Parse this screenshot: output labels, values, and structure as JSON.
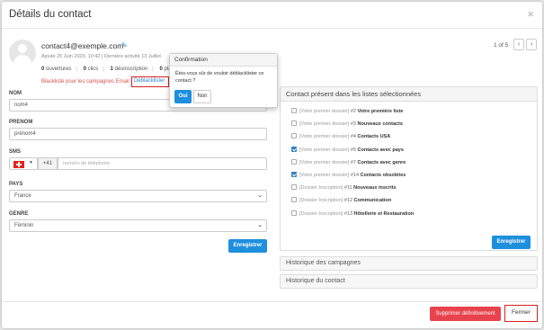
{
  "window": {
    "title": "Détails du contact",
    "close_icon": "×"
  },
  "contact": {
    "email": "contact4@exemple.com",
    "added": "Ajouté 25 Juin 2020, 10:42 | Dernière activité 13 Juillet",
    "stats": {
      "opens_value": "0",
      "opens_label": "ouvertures",
      "clicks_value": "0",
      "clicks_label": "clics",
      "unsub_value": "1",
      "unsub_label": "désinscription",
      "complaints_value": "0",
      "complaints_label": "plai"
    },
    "blacklist_text": "Blacklisté pour les campagnes Email &",
    "unblacklist_link": "Déblacklister"
  },
  "pager": {
    "text": "1 of 5",
    "prev": "‹",
    "next": "›"
  },
  "form": {
    "nom_label": "NOM",
    "nom_value": "nom4",
    "prenom_label": "PRENOM",
    "prenom_value": "prénom4",
    "sms_label": "SMS",
    "dial_code": "+41",
    "phone_placeholder": "numéro de téléphone",
    "pays_label": "PAYS",
    "pays_value": "France",
    "genre_label": "GENRE",
    "genre_value": "Féminin",
    "save_label": "Enregistrer"
  },
  "lists_panel": {
    "title": "Contact présent dans les listes sélectionnées",
    "items": [
      {
        "folder": "[Votre premier dossier]",
        "num": "#2",
        "name": "Votre première liste",
        "checked": false
      },
      {
        "folder": "[Votre premier dossier]",
        "num": "#3",
        "name": "Nouveaux contacts",
        "checked": false
      },
      {
        "folder": "[Votre premier dossier]",
        "num": "#4",
        "name": "Contacts USA",
        "checked": false
      },
      {
        "folder": "[Votre premier dossier]",
        "num": "#5",
        "name": "Contacts avec pays",
        "checked": true
      },
      {
        "folder": "[Votre premier dossier]",
        "num": "#7",
        "name": "Contacts avec genre",
        "checked": false
      },
      {
        "folder": "[Votre premier dossier]",
        "num": "#14",
        "name": "Contacts obsolètes",
        "checked": true
      },
      {
        "folder": "[Dossier Inscription]",
        "num": "#11",
        "name": "Nouveaux inscrits",
        "checked": false
      },
      {
        "folder": "[Dossier Inscription]",
        "num": "#12",
        "name": "Communication",
        "checked": false
      },
      {
        "folder": "[Dossier Inscription]",
        "num": "#13",
        "name": "Hôtellerie et Restauration",
        "checked": false
      }
    ],
    "save_label": "Enregistrer"
  },
  "accordions": {
    "campaigns": "Historique des campagnes",
    "contact": "Historique du contact"
  },
  "footer": {
    "delete_label": "Supprimer définitivement",
    "close_label": "Fermer"
  },
  "popover": {
    "title": "Confirmation",
    "message": "Êtes-vous sûr de vouloir déblacklister ce contact ?",
    "yes": "Oui",
    "no": "Non"
  },
  "icons": {
    "edit": "pencil-icon",
    "dropdown": "chevron-down-icon"
  }
}
